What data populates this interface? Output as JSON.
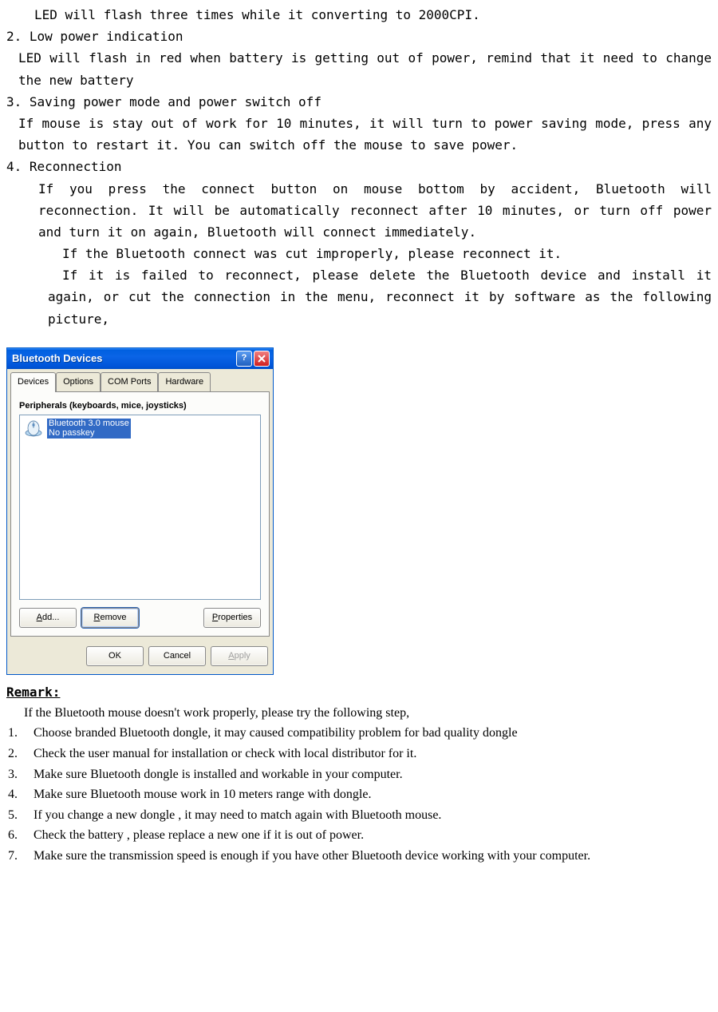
{
  "doc": {
    "line_led_2000cpi": "LED will flash three times while it converting to 2000CPI.",
    "item2_title": "2. Low power indication",
    "item2_body": "LED will flash in red when battery is getting out of power, remind that it need to change the new battery",
    "item3_title": "3. Saving power mode and power switch off",
    "item3_body": "If mouse is stay out of work for 10 minutes, it will turn to power saving mode, press any button to restart it. You can switch off the mouse to save power.",
    "item4_title": "4.  Reconnection",
    "item4_body1": "If you press the connect button on mouse bottom by accident, Bluetooth will reconnection. It will be automatically reconnect after 10 minutes, or turn off power and turn it on again, Bluetooth will connect immediately.",
    "item4_body2": "If the Bluetooth connect was cut improperly, please reconnect it.",
    "item4_body3": "If it is failed to reconnect, please delete the Bluetooth device and install it again, or cut the connection in the menu, reconnect it by software as the following picture,"
  },
  "dialog": {
    "title": "Bluetooth Devices",
    "tabs": {
      "devices": "Devices",
      "options": "Options",
      "comports": "COM Ports",
      "hardware": "Hardware"
    },
    "group_label": "Peripherals (keyboards, mice, joysticks)",
    "device_name": "Bluetooth 3.0 mouse",
    "device_sub": "No passkey",
    "buttons": {
      "add_pre": "A",
      "add_post": "dd...",
      "remove_pre": "R",
      "remove_post": "emove",
      "props_pre": "P",
      "props_post": "roperties",
      "ok": "OK",
      "cancel": "Cancel",
      "apply_pre": "A",
      "apply_post": "pply"
    }
  },
  "remark": {
    "heading": "Remark:",
    "intro": "If the Bluetooth mouse doesn't work properly, please try the following step,",
    "items": [
      "Choose branded Bluetooth dongle, it may caused compatibility problem for bad quality dongle",
      "Check the user manual for installation or check with local distributor for it.",
      "Make sure Bluetooth dongle is installed and workable in your computer.",
      "Make sure Bluetooth mouse work in 10 meters range with dongle.",
      "If you change a new dongle , it may need to match again with Bluetooth mouse.",
      "Check the battery , please replace a new one if it is out of power.",
      "Make sure the transmission speed is enough if you have other Bluetooth device working with your computer."
    ]
  }
}
